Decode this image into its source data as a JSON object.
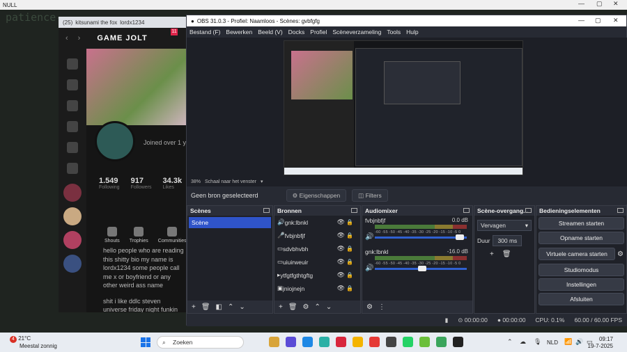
{
  "background": {
    "window_title": "NULL",
    "faint_text": "patience-"
  },
  "browser": {
    "tab_count": "(25)",
    "tab_title": "kitsunami the fox",
    "tab_extra": "lordx1234",
    "logo": "GAME JOLT",
    "badge": "11",
    "joined": "Joined over 1 y",
    "stats": [
      {
        "n": "1.549",
        "l": "Following"
      },
      {
        "n": "917",
        "l": "Followers"
      },
      {
        "n": "34.3k",
        "l": "Likes"
      }
    ],
    "tabs": [
      "Shouts",
      "Trophies",
      "Communities"
    ],
    "bio_lines": [
      "hello people who are reading",
      "this shitty bio my name is",
      "lordx1234 some people call",
      "me x or boyfriend or any",
      "other weird ass name",
      "",
      "shit i like ddlc steven",
      "universe friday night funkin"
    ]
  },
  "obs": {
    "title": "OBS 31.0.3 - Profiel: Naamloos - Scènes: gvbfgfg",
    "menu": [
      "Bestand (F)",
      "Bewerken",
      "Beeld (V)",
      "Docks",
      "Profiel",
      "Scèneverzameling",
      "Tools",
      "Hulp"
    ],
    "zoom": "38%",
    "zoom_label": "Schaal naar het venster",
    "no_source": "Geen bron geselecteerd",
    "properties": "Eigenschappen",
    "filters": "Filters",
    "scenes_title": "Scènes",
    "scenes": [
      "Scène"
    ],
    "sources_title": "Bronnen",
    "sources": [
      {
        "icon": "🔊",
        "name": "gnk:lbnkl"
      },
      {
        "icon": "🎤",
        "name": "fvbjnbfjf"
      },
      {
        "icon": "▭",
        "name": "sdvbhvbh"
      },
      {
        "icon": "▭",
        "name": "uiuirweuir"
      },
      {
        "icon": "▸",
        "name": "ytfgtfgthtgftg"
      },
      {
        "icon": "▣",
        "name": "jniojnejn"
      }
    ],
    "mixer_title": "Audiomixer",
    "channels": [
      {
        "name": "fvbjnbfjf",
        "db": "0.0 dB",
        "level": 0.97
      },
      {
        "name": "gnk:lbnkl",
        "db": "-16.0 dB",
        "level": 0.52
      }
    ],
    "meter_scale": "-60 -55 -50 -45 -40 -35 -30 -25 -20 -15 -10 -5 0",
    "transitions_title": "Scène-overgang...",
    "transition": "Vervagen",
    "duration_label": "Duur",
    "duration": "300 ms",
    "controls_title": "Bedieningselementen",
    "controls": [
      "Streamen starten",
      "Opname starten",
      "Virtuele camera starten",
      "Studiomodus",
      "Instellingen",
      "Afsluiten"
    ],
    "status": {
      "stream_time": "00:00:00",
      "rec_time": "00:00:00",
      "cpu": "CPU: 0.1%",
      "fps": "60.00 / 60.00 FPS"
    }
  },
  "taskbar": {
    "temp": "21°C",
    "weather": "Meestal zonnig",
    "weather_badge": "4",
    "search": "Zoeken",
    "lang": "NLD",
    "time": "09:17",
    "date": "19-7-2025",
    "apps": [
      "#d8a43a",
      "#5a4bd6",
      "#1e88e5",
      "#2bb0a6",
      "#d8263c",
      "#f4b400",
      "#e53935",
      "#444444",
      "#25d366",
      "#6bbf3a",
      "#3ba55c",
      "#222222"
    ]
  }
}
